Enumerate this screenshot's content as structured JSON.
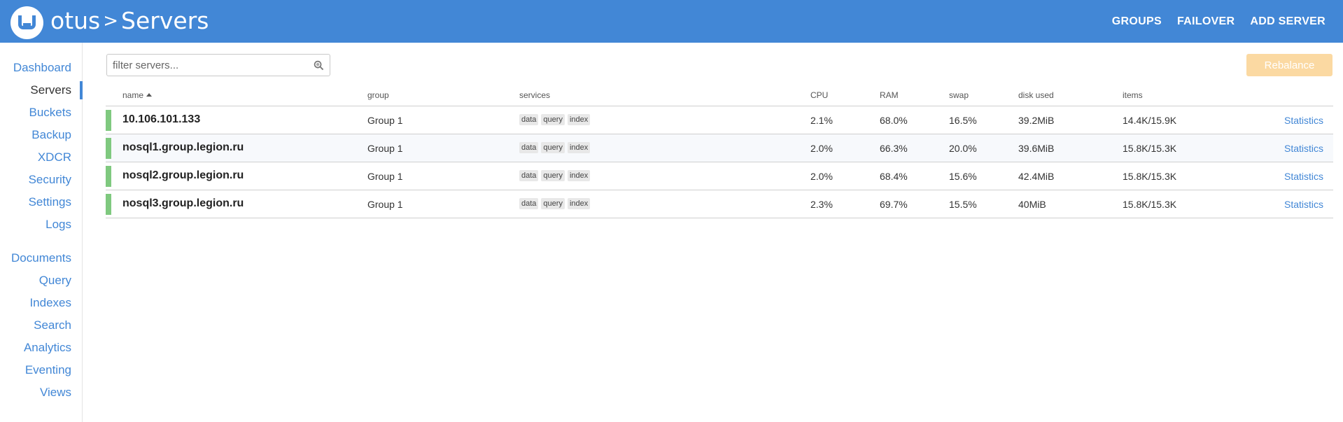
{
  "header": {
    "cluster_name": "otus",
    "separator": ">",
    "page_title": "Servers",
    "nav": [
      "GROUPS",
      "FAILOVER",
      "ADD SERVER"
    ],
    "color": "#4287d6"
  },
  "sidebar": {
    "items_top": [
      "Dashboard",
      "Servers",
      "Buckets",
      "Backup",
      "XDCR",
      "Security",
      "Settings",
      "Logs"
    ],
    "items_bottom": [
      "Documents",
      "Query",
      "Indexes",
      "Search",
      "Analytics",
      "Eventing",
      "Views"
    ],
    "active": "Servers"
  },
  "filter": {
    "placeholder": "filter servers..."
  },
  "rebalance_label": "Rebalance",
  "table": {
    "headers": {
      "name": "name",
      "group": "group",
      "services": "services",
      "cpu": "CPU",
      "ram": "RAM",
      "swap": "swap",
      "disk": "disk used",
      "items": "items"
    },
    "rows": [
      {
        "name": "10.106.101.133",
        "group": "Group 1",
        "services": [
          "data",
          "query",
          "index"
        ],
        "cpu": "2.1%",
        "ram": "68.0%",
        "swap": "16.5%",
        "disk": "39.2MiB",
        "items": "14.4K/15.9K",
        "stats": "Statistics"
      },
      {
        "name": "nosql1.group.legion.ru",
        "group": "Group 1",
        "services": [
          "data",
          "query",
          "index"
        ],
        "cpu": "2.0%",
        "ram": "66.3%",
        "swap": "20.0%",
        "disk": "39.6MiB",
        "items": "15.8K/15.3K",
        "stats": "Statistics"
      },
      {
        "name": "nosql2.group.legion.ru",
        "group": "Group 1",
        "services": [
          "data",
          "query",
          "index"
        ],
        "cpu": "2.0%",
        "ram": "68.4%",
        "swap": "15.6%",
        "disk": "42.4MiB",
        "items": "15.8K/15.3K",
        "stats": "Statistics"
      },
      {
        "name": "nosql3.group.legion.ru",
        "group": "Group 1",
        "services": [
          "data",
          "query",
          "index"
        ],
        "cpu": "2.3%",
        "ram": "69.7%",
        "swap": "15.5%",
        "disk": "40MiB",
        "items": "15.8K/15.3K",
        "stats": "Statistics"
      }
    ]
  },
  "colors": {
    "status_healthy": "#7fc97f",
    "rebalance_disabled": "#fbd9a2",
    "link": "#4287d6"
  }
}
